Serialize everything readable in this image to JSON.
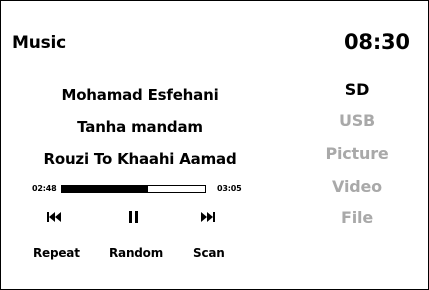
{
  "header": {
    "title": "Music",
    "clock": "08:30"
  },
  "track": {
    "artist": "Mohamad Esfehani",
    "album": "Tanha mandam",
    "song": "Rouzi To Khaahi Aamad"
  },
  "playback": {
    "elapsed": "02:48",
    "duration": "03:05",
    "progress_fraction": 0.6
  },
  "controls": {
    "previous_icon": "skip-previous-icon",
    "pause_icon": "pause-icon",
    "next_icon": "skip-next-icon"
  },
  "modes": {
    "repeat": "Repeat",
    "random": "Random",
    "scan": "Scan"
  },
  "sources": [
    {
      "label": "SD",
      "active": true
    },
    {
      "label": "USB",
      "active": false
    },
    {
      "label": "Picture",
      "active": false
    },
    {
      "label": "Video",
      "active": false
    },
    {
      "label": "File",
      "active": false
    }
  ],
  "colors": {
    "text": "#000000",
    "inactive": "#a9a9a9",
    "background": "#ffffff"
  }
}
